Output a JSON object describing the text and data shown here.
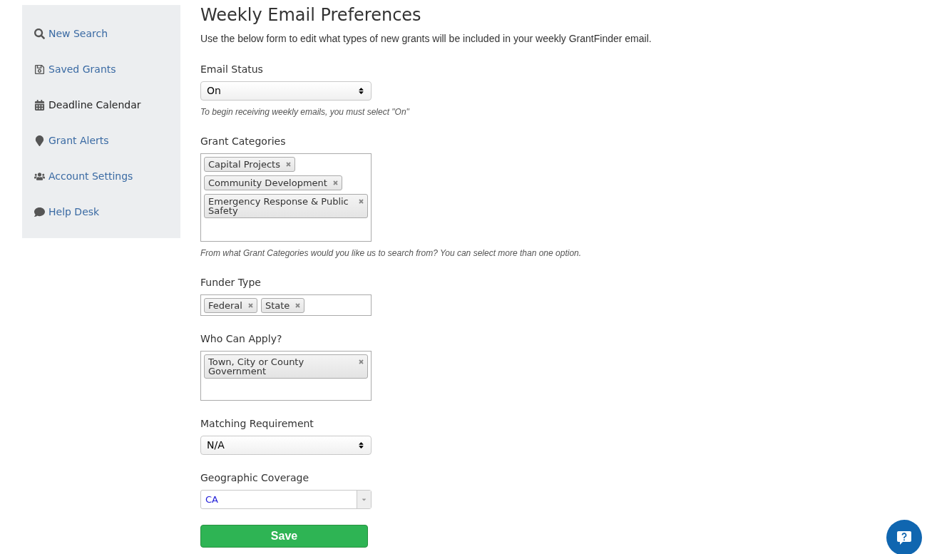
{
  "sidebar": {
    "items": [
      {
        "label": "New Search",
        "selected": false
      },
      {
        "label": "Saved Grants",
        "selected": false
      },
      {
        "label": "Deadline Calendar",
        "selected": true
      },
      {
        "label": "Grant Alerts",
        "selected": false
      },
      {
        "label": "Account Settings",
        "selected": false
      },
      {
        "label": "Help Desk",
        "selected": false
      }
    ]
  },
  "title": "Weekly Email Preferences",
  "intro": "Use the below form to edit what types of new grants will be included in your weekly GrantFinder email.",
  "fields": [
    {
      "kind": "select",
      "label": "Email Status",
      "value": "On",
      "help": "To begin receiving weekly emails, you must select \"On\""
    },
    {
      "kind": "tags",
      "label": "Grant Categories",
      "tags": [
        "Capital Projects",
        "Community Development",
        "Emergency Response & Public Safety"
      ],
      "help": "From what Grant Categories would you like us to search from? You can select more than one option."
    },
    {
      "kind": "tags",
      "label": "Funder Type",
      "tags": [
        "Federal",
        "State"
      ]
    },
    {
      "kind": "tags",
      "label": "Who Can Apply?",
      "tags": [
        "Town, City or County Government"
      ]
    },
    {
      "kind": "select",
      "label": "Matching Requirement",
      "value": "N/A"
    },
    {
      "kind": "combo",
      "label": "Geographic Coverage",
      "value": "CA"
    }
  ],
  "save_button": "Save"
}
